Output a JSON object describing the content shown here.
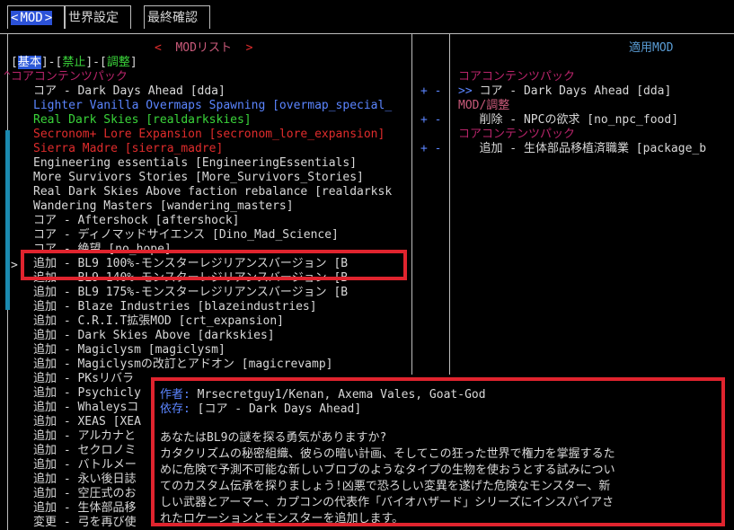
{
  "tabs": {
    "left_arrow": "<",
    "active": "MOD",
    "right_arrow": ">",
    "world_settings": "世界設定",
    "final_confirm": "最終確認"
  },
  "left_panel": {
    "title_left": "<",
    "title": "MODリスト",
    "title_right": ">",
    "filter": {
      "open1": "[",
      "basic": "基本",
      "sep1": "]-[",
      "banned": "禁止",
      "sep2": "]-[",
      "tweak": "調整",
      "close": "]"
    },
    "category": "^コアコンテンツパック",
    "items": [
      {
        "text": "コア - Dark Days Ahead [dda]",
        "color": "#d8d8d8"
      },
      {
        "text": "Lighter Vanilla Overmaps Spawning [overmap_special_",
        "color": "#5b85ff"
      },
      {
        "text": "Real Dark Skies [realdarkskies]",
        "color": "#3ad43a"
      },
      {
        "text": "Secronom+ Lore Expansion [secronom_lore_expansion]",
        "color": "#e02c2c"
      },
      {
        "text": "Sierra Madre [sierra_madre]",
        "color": "#e02c2c"
      },
      {
        "text": "Engineering essentials [EngineeringEssentials]",
        "color": "#d8d8d8"
      },
      {
        "text": "More Survivors Stories [More_Survivors_Stories]",
        "color": "#d8d8d8"
      },
      {
        "text": "Real Dark Skies Above faction rebalance [realdarksk",
        "color": "#d8d8d8"
      },
      {
        "text": "Wandering Masters [wandering_masters]",
        "color": "#d8d8d8"
      },
      {
        "text": "コア - Aftershock [aftershock]",
        "color": "#d8d8d8"
      },
      {
        "text": "コア - ディノマッドサイエンス [Dino_Mad_Science]",
        "color": "#d8d8d8"
      },
      {
        "text": "コア - 絶望 [no_hope]",
        "color": "#d8d8d8"
      },
      {
        "text": "追加 - BL9 100%-モンスターレジリアンスバージョン [B",
        "color": "#d8d8d8"
      },
      {
        "text": "追加 - BL9 140%-モンスターレジリアンスバージョン [B",
        "color": "#d8d8d8"
      },
      {
        "text": "追加 - BL9 175%-モンスターレジリアンスバージョン [B",
        "color": "#d8d8d8"
      },
      {
        "text": "追加 - Blaze Industries [blazeindustries]",
        "color": "#d8d8d8"
      },
      {
        "text": "追加 - C.R.I.T拡張MOD [crt_expansion]",
        "color": "#d8d8d8"
      },
      {
        "text": "追加 - Dark Skies Above [darkskies]",
        "color": "#d8d8d8"
      },
      {
        "text": "追加 - Magiclysm [magiclysm]",
        "color": "#d8d8d8"
      },
      {
        "text": "追加 - Magiclysmの改訂とアドオン [magicrevamp]",
        "color": "#d8d8d8"
      },
      {
        "text": "追加 - PKsリバラ",
        "color": "#d8d8d8"
      },
      {
        "text": "追加 - Psychicly",
        "color": "#d8d8d8"
      },
      {
        "text": "追加 - Whaleysコ",
        "color": "#d8d8d8"
      },
      {
        "text": "追加 - XEAS [XEA",
        "color": "#d8d8d8"
      },
      {
        "text": "追加 - アルカナと",
        "color": "#d8d8d8"
      },
      {
        "text": "追加 - セクロノミ",
        "color": "#d8d8d8"
      },
      {
        "text": "追加 - バトルメー",
        "color": "#d8d8d8"
      },
      {
        "text": "追加 - 永い後日誌",
        "color": "#d8d8d8"
      },
      {
        "text": "追加 - 空圧式のお",
        "color": "#d8d8d8"
      },
      {
        "text": "追加 - 生体部品移",
        "color": "#d8d8d8"
      },
      {
        "text": "変更 - 弓を再び使",
        "color": "#d8d8d8"
      }
    ],
    "cursor": ">"
  },
  "right_panel": {
    "title": "適用MOD",
    "groups": [
      {
        "header": "コアコンテンツパック",
        "header_color": "#b8246a",
        "item_prefix": ">>",
        "item": "コア - Dark Days Ahead [dda]"
      },
      {
        "header": "MOD/調整",
        "header_color": "#c95a7a",
        "item_prefix": "",
        "item": "削除 - NPCの欲求 [no_npc_food]"
      },
      {
        "header": "コアコンテンツパック",
        "header_color": "#b8246a",
        "item_prefix": "",
        "item": "追加 - 生体部品移植済職業 [package_b"
      }
    ],
    "plus": "+",
    "minus": "-"
  },
  "popup": {
    "author_label": "作者:",
    "author": " Mrsecretguy1/Kenan, Axema Vales, Goat-God",
    "deps_label": "依存:",
    "deps": " [コア - Dark Days Ahead]",
    "desc_lines": [
      "あなたはBL9の謎を探る勇気がありますか?",
      "カタクリズムの秘密組織、彼らの暗い計画、そしてこの狂った世界で権力を掌握するた",
      "めに危険で予測不可能な新しいブロブのようなタイプの生物を使おうとする試みについ",
      "てのカスタム伝承を探りましょう!凶悪で恐ろしい変異を遂げた危険なモンスター、新",
      "しい武器とアーマー、カプコンの代表作「バイオハザード」シリーズにインスパイアさ",
      "れたロケーションとモンスターを追加します。"
    ]
  },
  "colors": {
    "accent_blue": "#2c52d8",
    "highlight_red": "#e0242e",
    "category_magenta": "#b8246a"
  }
}
